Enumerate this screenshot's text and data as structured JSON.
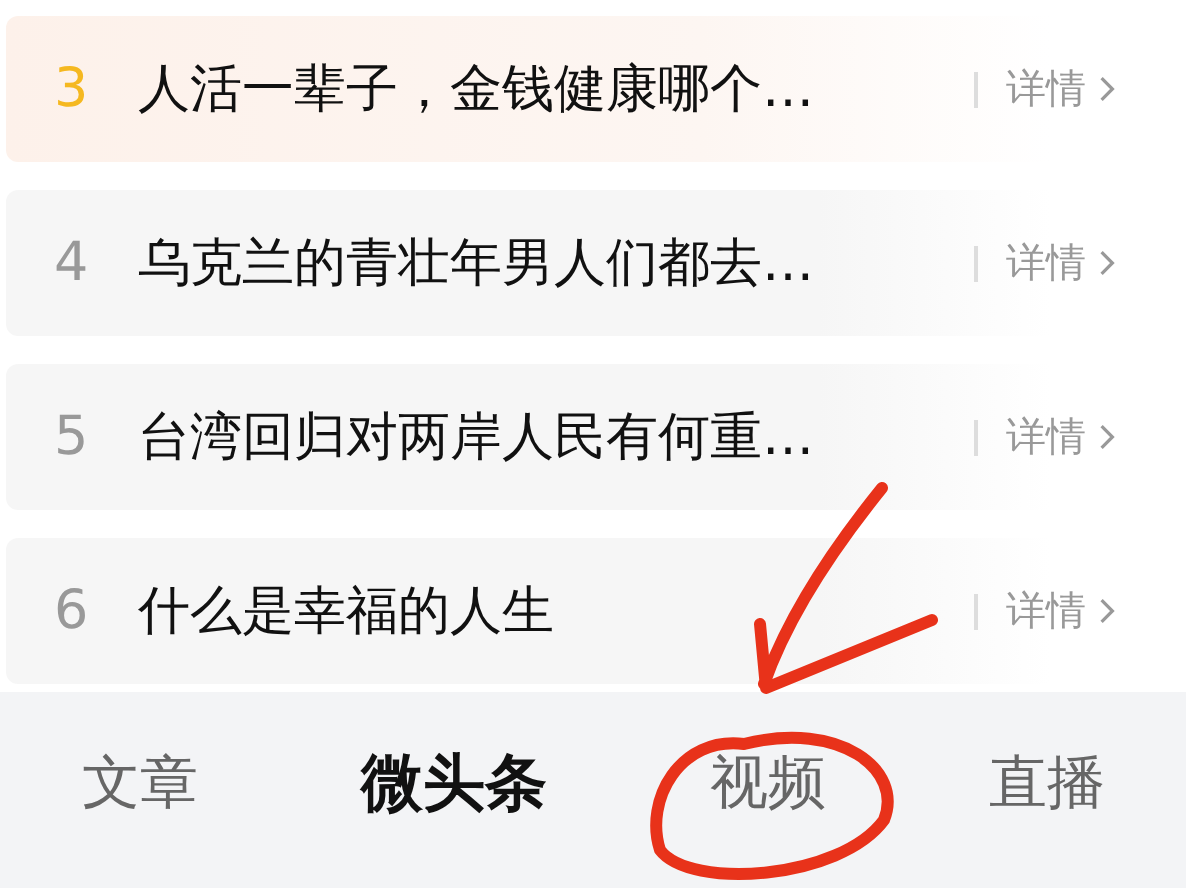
{
  "list": [
    {
      "rank": "3",
      "title": "人活一辈子，金钱健康哪个…",
      "hot": true,
      "action": "详情"
    },
    {
      "rank": "4",
      "title": "乌克兰的青壮年男人们都去…",
      "hot": false,
      "action": "详情"
    },
    {
      "rank": "5",
      "title": "台湾回归对两岸人民有何重…",
      "hot": false,
      "action": "详情"
    },
    {
      "rank": "6",
      "title": "什么是幸福的人生",
      "hot": false,
      "action": "详情"
    }
  ],
  "tabs": [
    {
      "label": "文章",
      "selected": false
    },
    {
      "label": "微头条",
      "selected": true
    },
    {
      "label": "视频",
      "selected": false
    },
    {
      "label": "直播",
      "selected": false
    }
  ]
}
